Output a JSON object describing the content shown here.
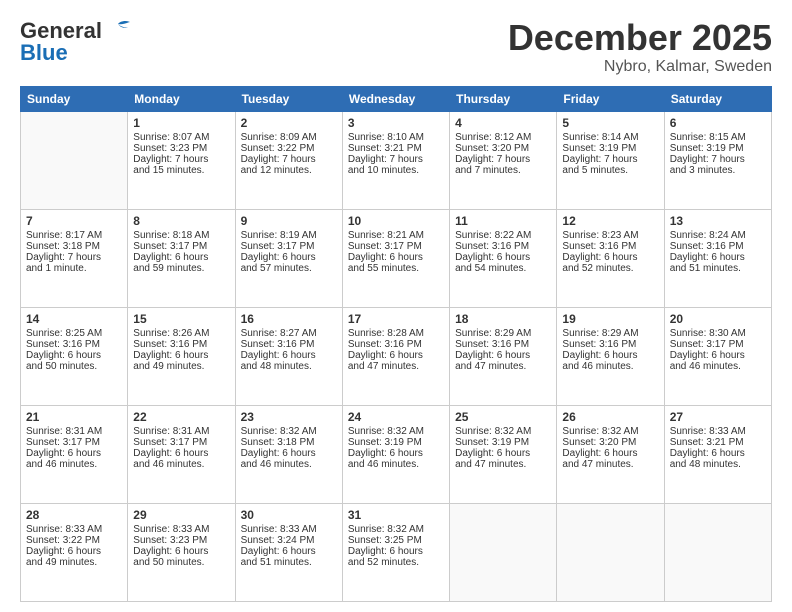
{
  "header": {
    "logo_general": "General",
    "logo_blue": "Blue",
    "month": "December 2025",
    "location": "Nybro, Kalmar, Sweden"
  },
  "days_of_week": [
    "Sunday",
    "Monday",
    "Tuesday",
    "Wednesday",
    "Thursday",
    "Friday",
    "Saturday"
  ],
  "weeks": [
    [
      {
        "day": "",
        "info": ""
      },
      {
        "day": "1",
        "info": "Sunrise: 8:07 AM\nSunset: 3:23 PM\nDaylight: 7 hours\nand 15 minutes."
      },
      {
        "day": "2",
        "info": "Sunrise: 8:09 AM\nSunset: 3:22 PM\nDaylight: 7 hours\nand 12 minutes."
      },
      {
        "day": "3",
        "info": "Sunrise: 8:10 AM\nSunset: 3:21 PM\nDaylight: 7 hours\nand 10 minutes."
      },
      {
        "day": "4",
        "info": "Sunrise: 8:12 AM\nSunset: 3:20 PM\nDaylight: 7 hours\nand 7 minutes."
      },
      {
        "day": "5",
        "info": "Sunrise: 8:14 AM\nSunset: 3:19 PM\nDaylight: 7 hours\nand 5 minutes."
      },
      {
        "day": "6",
        "info": "Sunrise: 8:15 AM\nSunset: 3:19 PM\nDaylight: 7 hours\nand 3 minutes."
      }
    ],
    [
      {
        "day": "7",
        "info": "Sunrise: 8:17 AM\nSunset: 3:18 PM\nDaylight: 7 hours\nand 1 minute."
      },
      {
        "day": "8",
        "info": "Sunrise: 8:18 AM\nSunset: 3:17 PM\nDaylight: 6 hours\nand 59 minutes."
      },
      {
        "day": "9",
        "info": "Sunrise: 8:19 AM\nSunset: 3:17 PM\nDaylight: 6 hours\nand 57 minutes."
      },
      {
        "day": "10",
        "info": "Sunrise: 8:21 AM\nSunset: 3:17 PM\nDaylight: 6 hours\nand 55 minutes."
      },
      {
        "day": "11",
        "info": "Sunrise: 8:22 AM\nSunset: 3:16 PM\nDaylight: 6 hours\nand 54 minutes."
      },
      {
        "day": "12",
        "info": "Sunrise: 8:23 AM\nSunset: 3:16 PM\nDaylight: 6 hours\nand 52 minutes."
      },
      {
        "day": "13",
        "info": "Sunrise: 8:24 AM\nSunset: 3:16 PM\nDaylight: 6 hours\nand 51 minutes."
      }
    ],
    [
      {
        "day": "14",
        "info": "Sunrise: 8:25 AM\nSunset: 3:16 PM\nDaylight: 6 hours\nand 50 minutes."
      },
      {
        "day": "15",
        "info": "Sunrise: 8:26 AM\nSunset: 3:16 PM\nDaylight: 6 hours\nand 49 minutes."
      },
      {
        "day": "16",
        "info": "Sunrise: 8:27 AM\nSunset: 3:16 PM\nDaylight: 6 hours\nand 48 minutes."
      },
      {
        "day": "17",
        "info": "Sunrise: 8:28 AM\nSunset: 3:16 PM\nDaylight: 6 hours\nand 47 minutes."
      },
      {
        "day": "18",
        "info": "Sunrise: 8:29 AM\nSunset: 3:16 PM\nDaylight: 6 hours\nand 47 minutes."
      },
      {
        "day": "19",
        "info": "Sunrise: 8:29 AM\nSunset: 3:16 PM\nDaylight: 6 hours\nand 46 minutes."
      },
      {
        "day": "20",
        "info": "Sunrise: 8:30 AM\nSunset: 3:17 PM\nDaylight: 6 hours\nand 46 minutes."
      }
    ],
    [
      {
        "day": "21",
        "info": "Sunrise: 8:31 AM\nSunset: 3:17 PM\nDaylight: 6 hours\nand 46 minutes."
      },
      {
        "day": "22",
        "info": "Sunrise: 8:31 AM\nSunset: 3:17 PM\nDaylight: 6 hours\nand 46 minutes."
      },
      {
        "day": "23",
        "info": "Sunrise: 8:32 AM\nSunset: 3:18 PM\nDaylight: 6 hours\nand 46 minutes."
      },
      {
        "day": "24",
        "info": "Sunrise: 8:32 AM\nSunset: 3:19 PM\nDaylight: 6 hours\nand 46 minutes."
      },
      {
        "day": "25",
        "info": "Sunrise: 8:32 AM\nSunset: 3:19 PM\nDaylight: 6 hours\nand 47 minutes."
      },
      {
        "day": "26",
        "info": "Sunrise: 8:32 AM\nSunset: 3:20 PM\nDaylight: 6 hours\nand 47 minutes."
      },
      {
        "day": "27",
        "info": "Sunrise: 8:33 AM\nSunset: 3:21 PM\nDaylight: 6 hours\nand 48 minutes."
      }
    ],
    [
      {
        "day": "28",
        "info": "Sunrise: 8:33 AM\nSunset: 3:22 PM\nDaylight: 6 hours\nand 49 minutes."
      },
      {
        "day": "29",
        "info": "Sunrise: 8:33 AM\nSunset: 3:23 PM\nDaylight: 6 hours\nand 50 minutes."
      },
      {
        "day": "30",
        "info": "Sunrise: 8:33 AM\nSunset: 3:24 PM\nDaylight: 6 hours\nand 51 minutes."
      },
      {
        "day": "31",
        "info": "Sunrise: 8:32 AM\nSunset: 3:25 PM\nDaylight: 6 hours\nand 52 minutes."
      },
      {
        "day": "",
        "info": ""
      },
      {
        "day": "",
        "info": ""
      },
      {
        "day": "",
        "info": ""
      }
    ]
  ]
}
